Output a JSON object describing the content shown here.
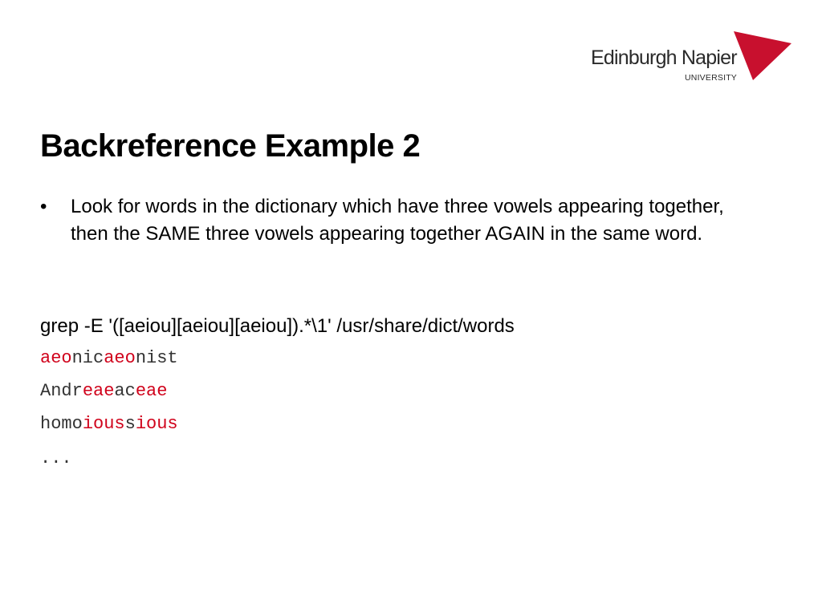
{
  "logo": {
    "name": "Edinburgh Napier",
    "subtitle": "UNIVERSITY",
    "mark_color": "#c8102e"
  },
  "slide": {
    "title": "Backreference Example 2",
    "bullet_marker": "•",
    "bullet_text": "Look for words in the dictionary which have three vowels  appearing together, then the SAME three vowels appearing together AGAIN in the same word.",
    "command": "grep -E '([aeiou][aeiou][aeiou]).*\\1' /usr/share/dict/words",
    "results": [
      {
        "p1": "",
        "m1": "aeo",
        "p2": "nic",
        "m2": "aeo",
        "p3": "nist"
      },
      {
        "p1": "Andr",
        "m1": "eae",
        "p2": "ac",
        "m2": "eae",
        "p3": ""
      },
      {
        "p1": "homo",
        "m1": "ious",
        "p2": "s",
        "m2": "ious",
        "p3": ""
      }
    ],
    "ellipsis": "...",
    "highlight_color": "#d0021b"
  }
}
